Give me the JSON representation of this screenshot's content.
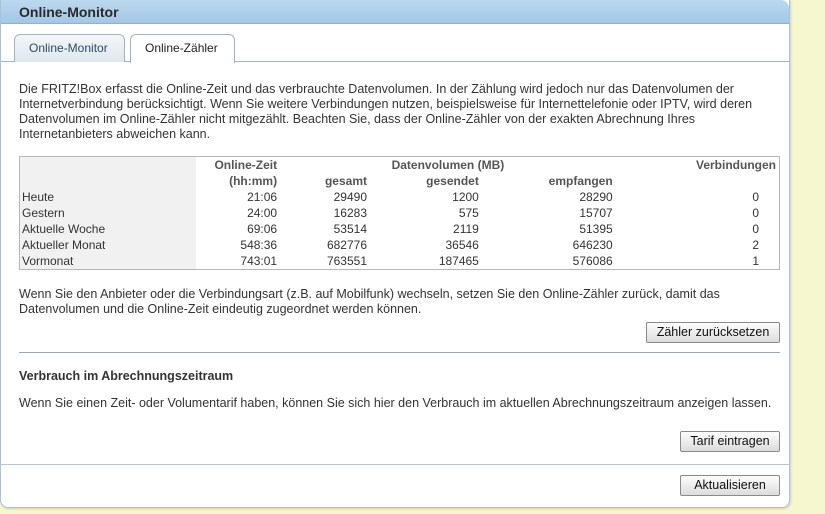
{
  "window": {
    "title": "Online-Monitor"
  },
  "tabs": [
    {
      "label": "Online-Monitor"
    },
    {
      "label": "Online-Zähler"
    }
  ],
  "intro": "Die FRITZ!Box erfasst die Online-Zeit und das verbrauchte Datenvolumen. In der Zählung wird jedoch nur das Datenvolumen der Internetverbindung berücksichtigt. Wenn Sie weitere Verbindungen nutzen, beispielsweise für Internettelefonie oder IPTV, wird deren Datenvolumen im Online-Zähler nicht mitgezählt. Beachten Sie, dass der Online-Zähler von der exakten Abrechnung Ihres Internetanbieters abweichen kann.",
  "table": {
    "head": {
      "online_zeit": "Online-Zeit",
      "hhmm": "(hh:mm)",
      "datenvolumen": "Datenvolumen (MB)",
      "gesamt": "gesamt",
      "gesendet": "gesendet",
      "empfangen": "empfangen",
      "verbindungen": "Verbindungen"
    },
    "rows": [
      {
        "label": "Heute",
        "time": "21:06",
        "total": "29490",
        "sent": "1200",
        "received": "28290",
        "connections": "0"
      },
      {
        "label": "Gestern",
        "time": "24:00",
        "total": "16283",
        "sent": "575",
        "received": "15707",
        "connections": "0"
      },
      {
        "label": "Aktuelle Woche",
        "time": "69:06",
        "total": "53514",
        "sent": "2119",
        "received": "51395",
        "connections": "0"
      },
      {
        "label": "Aktueller Monat",
        "time": "548:36",
        "total": "682776",
        "sent": "36546",
        "received": "646230",
        "connections": "2"
      },
      {
        "label": "Vormonat",
        "time": "743:01",
        "total": "763551",
        "sent": "187465",
        "received": "576086",
        "connections": "1"
      }
    ]
  },
  "reset_text": "Wenn Sie den Anbieter oder die Verbindungsart (z.B. auf Mobilfunk) wechseln, setzen Sie den Online-Zähler zurück, damit das Datenvolumen und die Online-Zeit eindeutig zugeordnet werden können.",
  "reset_button": "Zähler zurücksetzen",
  "billing": {
    "title": "Verbrauch im Abrechnungszeitraum",
    "text": "Wenn Sie einen Zeit- oder Volumentarif haben, können Sie sich hier den Verbrauch im aktuellen Abrechnungszeitraum anzeigen lassen.",
    "button": "Tarif eintragen"
  },
  "refresh_button": "Aktualisieren"
}
